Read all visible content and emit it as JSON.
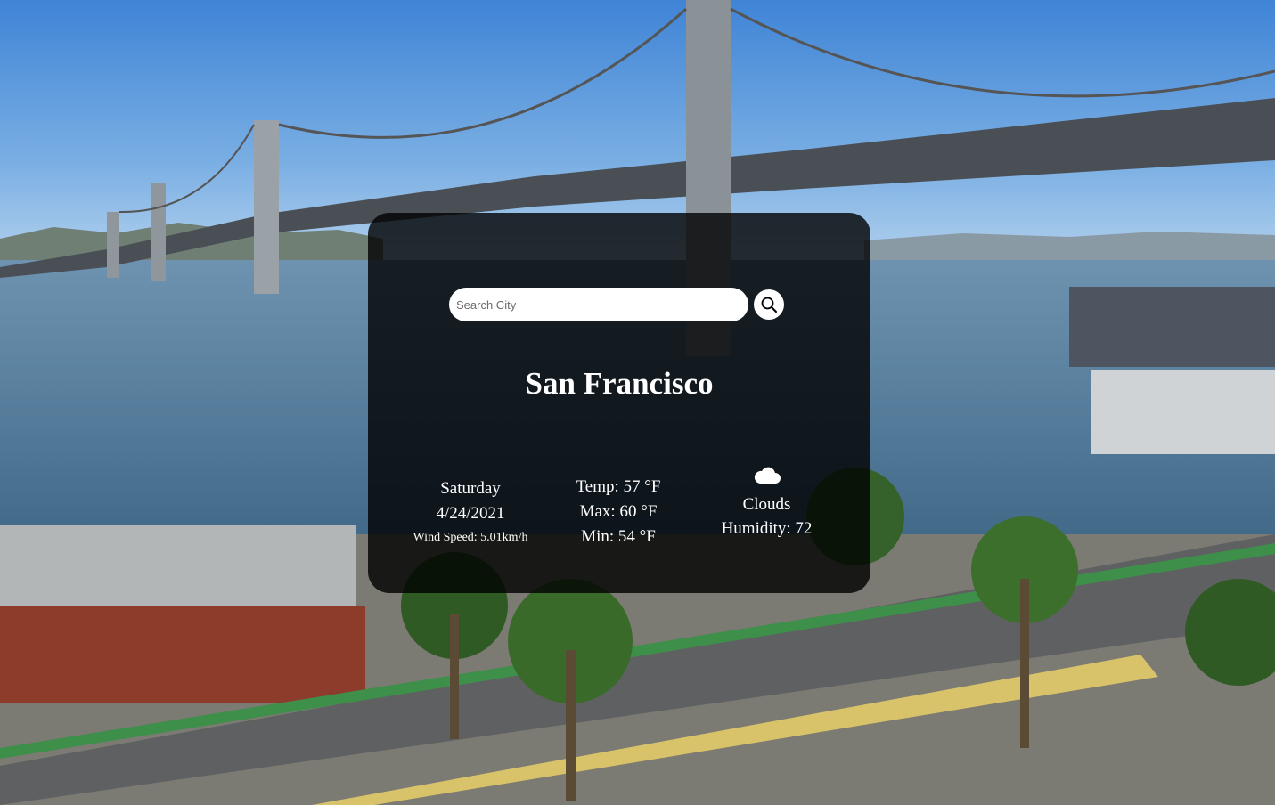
{
  "search": {
    "placeholder": "Search City",
    "value": "",
    "icon": "search-icon"
  },
  "weather": {
    "city": "San Francisco",
    "day": "Saturday",
    "date": "4/24/2021",
    "wind_speed": "Wind Speed: 5.01km/h",
    "temp": "Temp: 57 °F",
    "max": "Max: 60 °F",
    "min": "Min: 54 °F",
    "condition_icon": "cloud-icon",
    "condition": "Clouds",
    "humidity": "Humidity: 72"
  },
  "colors": {
    "card_background": "#000000",
    "text": "#ffffff",
    "input_background": "#ffffff"
  }
}
